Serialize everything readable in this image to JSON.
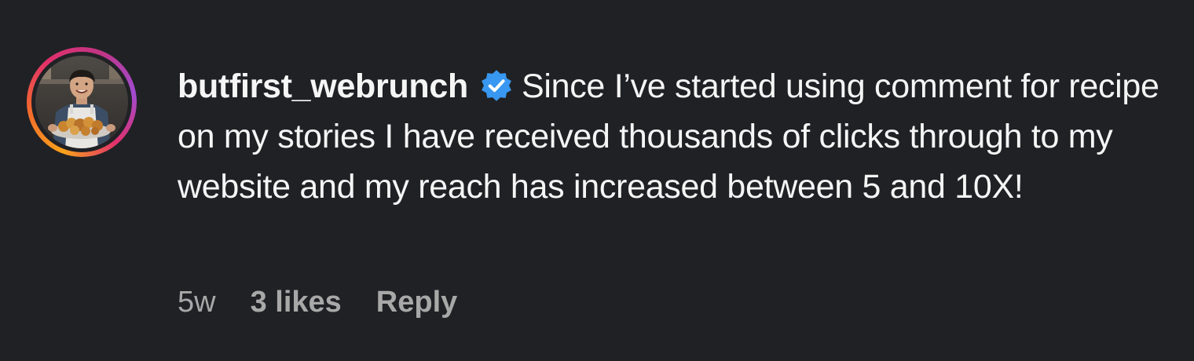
{
  "comment": {
    "username": "butfirst_webrunch",
    "verified": true,
    "text": "Since I’ve started using comment for recipe on my stories I have received thousands of clicks through to my website and my reach has increased between 5 and 10X!",
    "time": "5w",
    "likes": "3 likes",
    "reply_label": "Reply"
  },
  "icons": {
    "avatar": "profile-photo",
    "verified": "verified-badge-icon"
  },
  "colors": {
    "background": "#202125",
    "text": "#f5f5f5",
    "meta": "#a8a8a8",
    "verified": "#3897f0",
    "ring_start": "#f9a21b",
    "ring_end": "#c13584"
  }
}
